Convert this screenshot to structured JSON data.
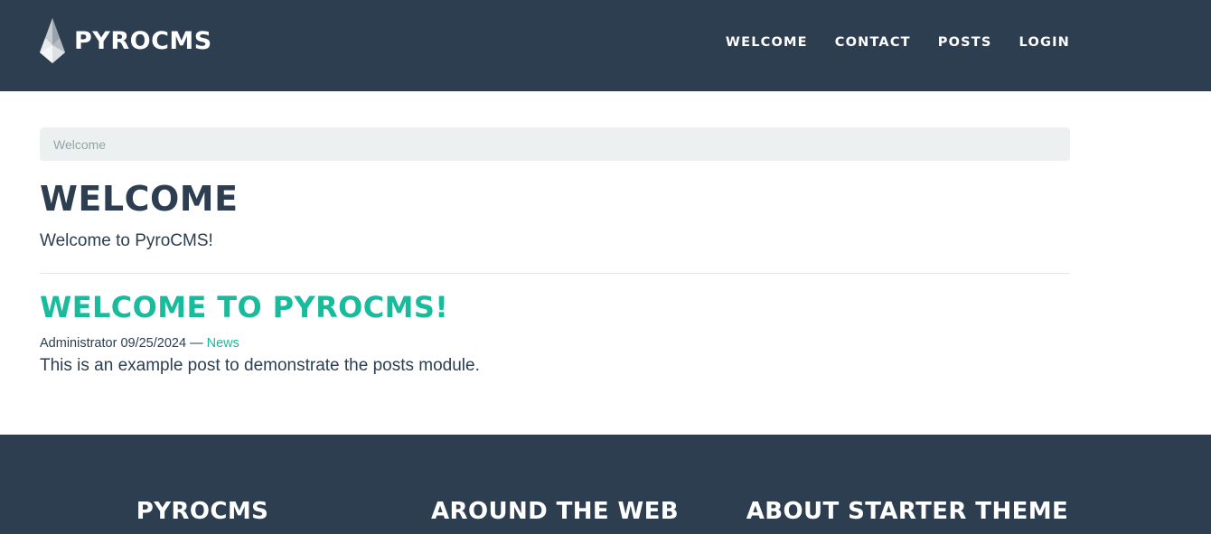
{
  "header": {
    "brand": "PYROCMS",
    "logo_icon": "flame-crystal-icon",
    "nav": [
      "WELCOME",
      "CONTACT",
      "POSTS",
      "LOGIN"
    ]
  },
  "breadcrumb": {
    "current": "Welcome"
  },
  "page": {
    "title": "WELCOME",
    "lead": "Welcome to PyroCMS!"
  },
  "post": {
    "title": "WELCOME TO PYROCMS!",
    "author": "Administrator",
    "date": "09/25/2024",
    "separator": "—",
    "category": "News",
    "summary": "This is an example post to demonstrate the posts module."
  },
  "footer": {
    "columns": [
      "PYROCMS",
      "AROUND THE WEB",
      "ABOUT STARTER THEME"
    ]
  },
  "colors": {
    "primary": "#2d3e50",
    "accent": "#18bc9c",
    "muted_bg": "#ecf0f1"
  }
}
